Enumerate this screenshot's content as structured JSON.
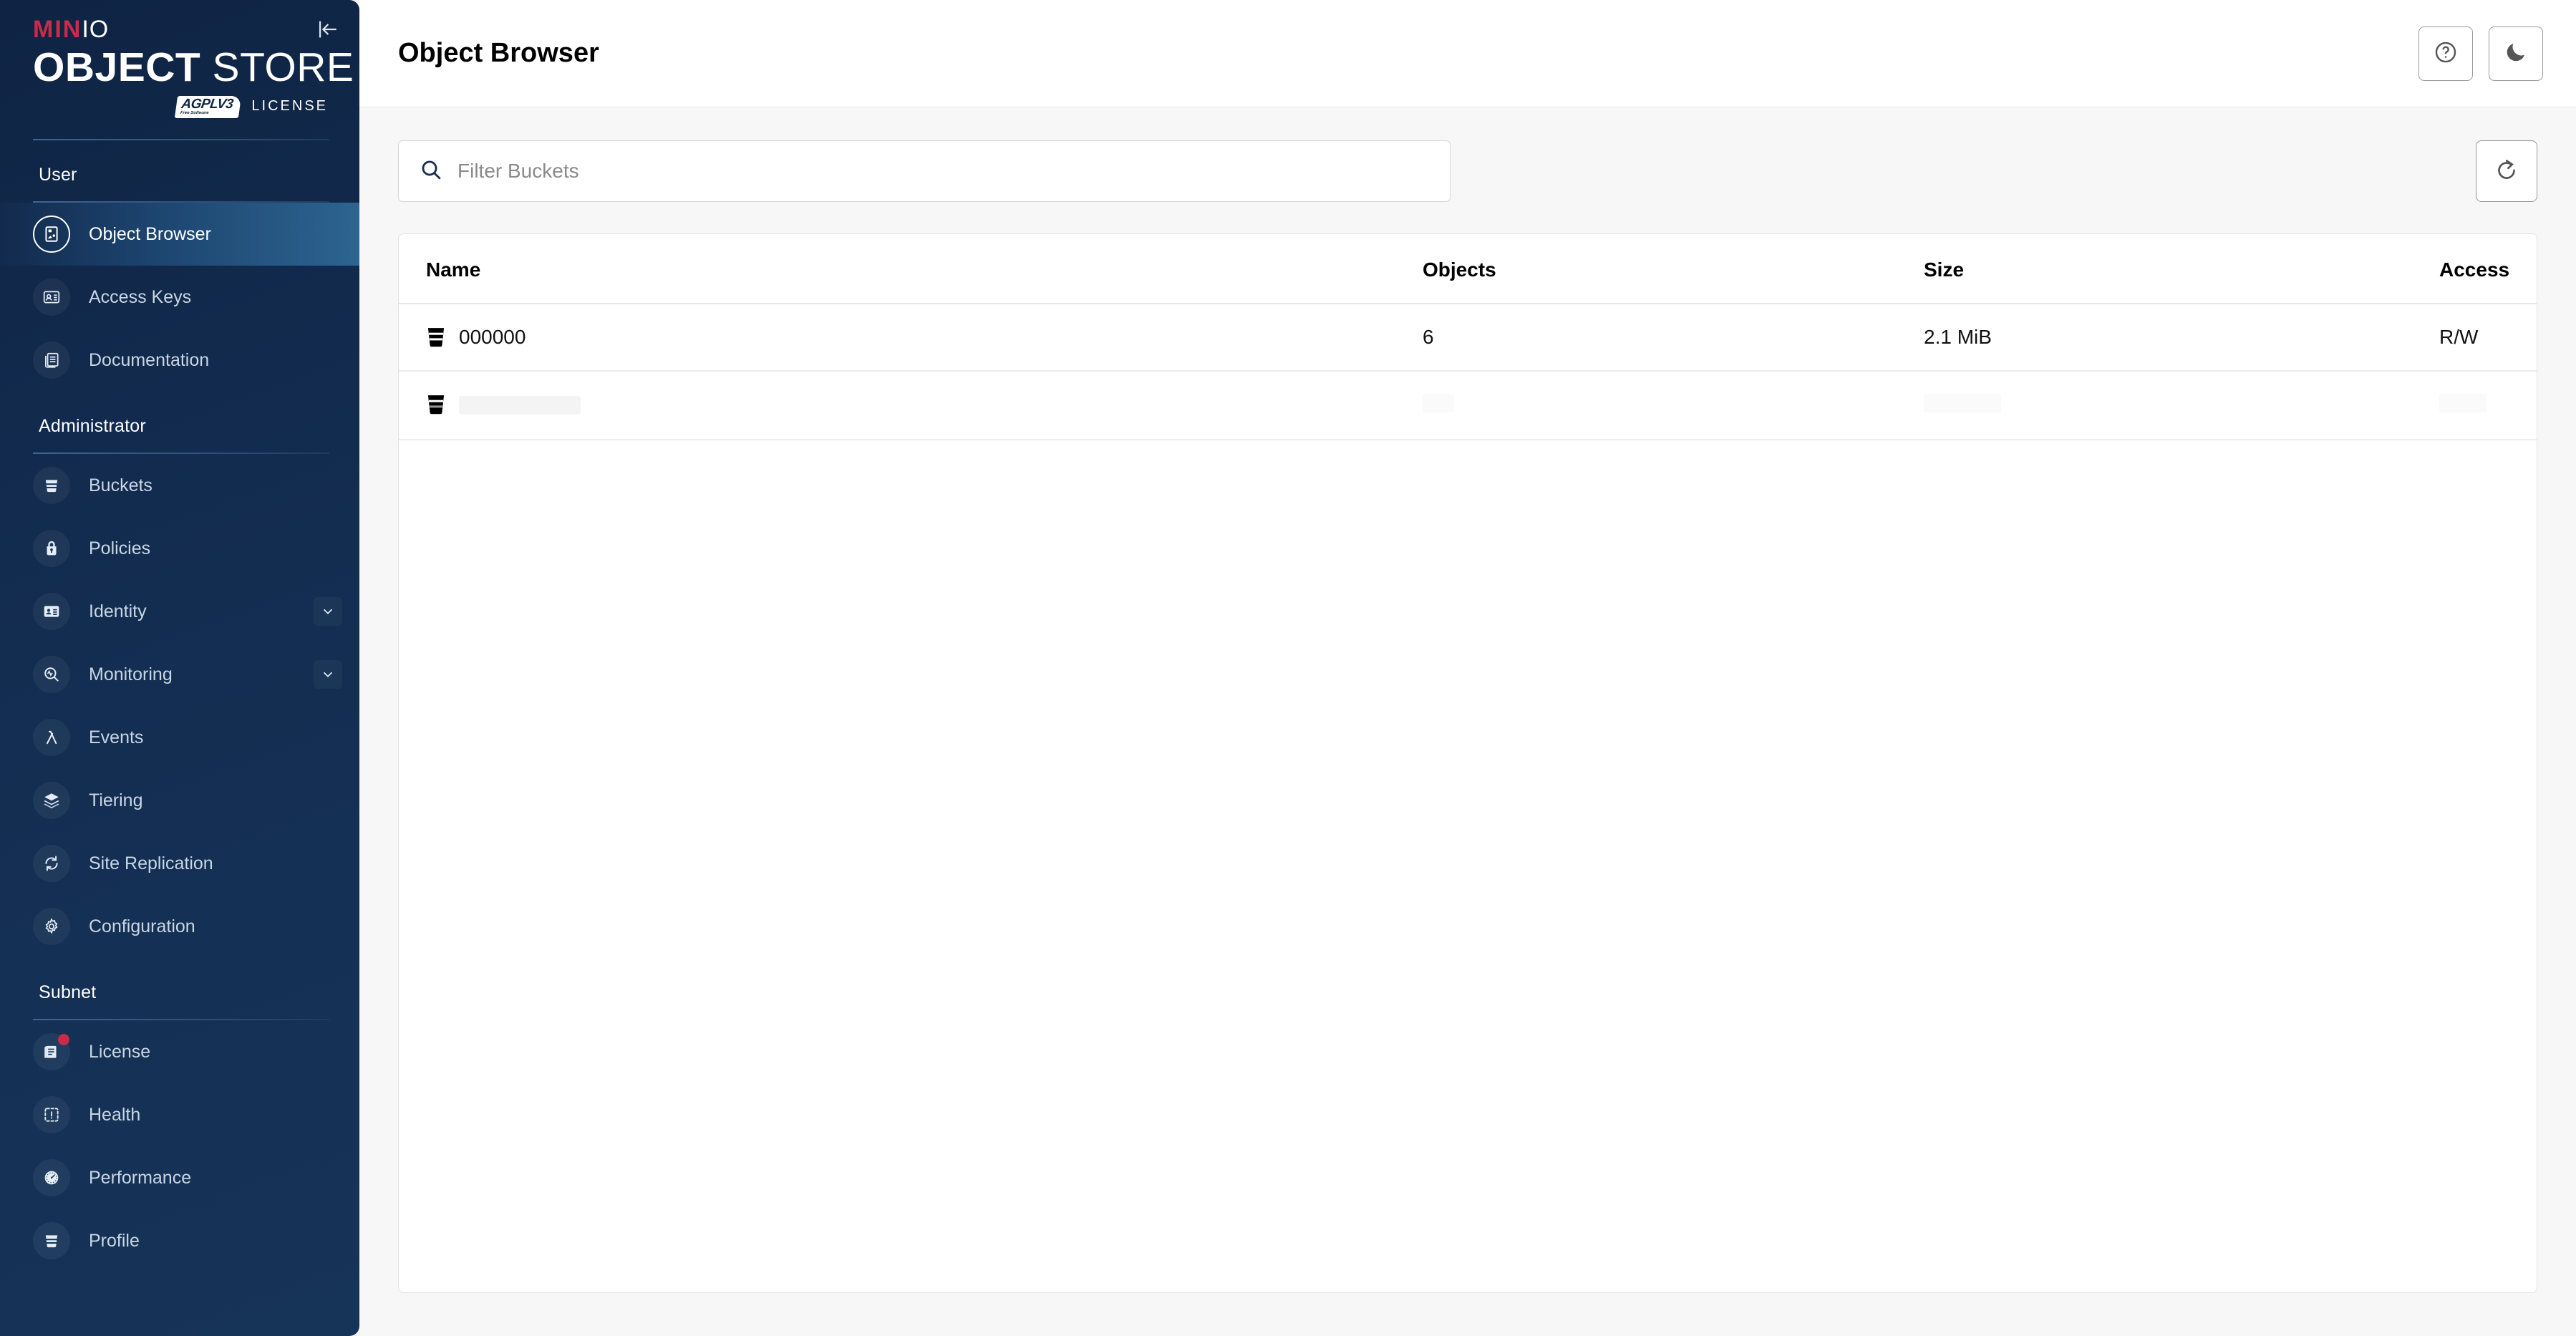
{
  "sidebar": {
    "logo": {
      "brand_min": "MIN",
      "brand_io": "IO",
      "product_bold": "OBJECT",
      "product_light": "STORE",
      "agpl_main": "AGPLV3",
      "agpl_sub": "Free Software",
      "license_word": "LICENSE"
    },
    "collapse_icon": "collapse-sidebar-icon",
    "sections": [
      {
        "label": "User",
        "items": [
          {
            "label": "Object Browser",
            "icon": "object-browser-icon",
            "active": true,
            "chevron": false,
            "badge": false
          },
          {
            "label": "Access Keys",
            "icon": "access-keys-icon",
            "active": false,
            "chevron": false,
            "badge": false
          },
          {
            "label": "Documentation",
            "icon": "documentation-icon",
            "active": false,
            "chevron": false,
            "badge": false
          }
        ]
      },
      {
        "label": "Administrator",
        "items": [
          {
            "label": "Buckets",
            "icon": "bucket-icon",
            "active": false,
            "chevron": false,
            "badge": false
          },
          {
            "label": "Policies",
            "icon": "lock-icon",
            "active": false,
            "chevron": false,
            "badge": false
          },
          {
            "label": "Identity",
            "icon": "identity-card-icon",
            "active": false,
            "chevron": true,
            "badge": false
          },
          {
            "label": "Monitoring",
            "icon": "monitoring-icon",
            "active": false,
            "chevron": true,
            "badge": false
          },
          {
            "label": "Events",
            "icon": "lambda-icon",
            "active": false,
            "chevron": false,
            "badge": false
          },
          {
            "label": "Tiering",
            "icon": "layers-icon",
            "active": false,
            "chevron": false,
            "badge": false
          },
          {
            "label": "Site Replication",
            "icon": "sync-icon",
            "active": false,
            "chevron": false,
            "badge": false
          },
          {
            "label": "Configuration",
            "icon": "gear-icon",
            "active": false,
            "chevron": false,
            "badge": false
          }
        ]
      },
      {
        "label": "Subnet",
        "items": [
          {
            "label": "License",
            "icon": "license-document-icon",
            "active": false,
            "chevron": false,
            "badge": true
          },
          {
            "label": "Health",
            "icon": "health-icon",
            "active": false,
            "chevron": false,
            "badge": false
          },
          {
            "label": "Performance",
            "icon": "gauge-icon",
            "active": false,
            "chevron": false,
            "badge": false
          },
          {
            "label": "Profile",
            "icon": "profile-bucket-icon",
            "active": false,
            "chevron": false,
            "badge": false
          }
        ]
      }
    ]
  },
  "topbar": {
    "title": "Object Browser",
    "help_icon": "help-circle-icon",
    "theme_icon": "moon-icon"
  },
  "toolbar": {
    "search_placeholder": "Filter Buckets",
    "search_value": "",
    "search_icon": "search-icon",
    "refresh_icon": "refresh-icon"
  },
  "table": {
    "columns": [
      "Name",
      "Objects",
      "Size",
      "Access"
    ],
    "rows": [
      {
        "name": "000000",
        "objects": "6",
        "size": "2.1 MiB",
        "access": "R/W",
        "loading": false
      },
      {
        "name": "",
        "objects": "",
        "size": "",
        "access": "",
        "loading": true
      }
    ]
  },
  "colors": {
    "sidebar_bg": "#132d51",
    "sidebar_active": "#2d6490",
    "brand_red": "#c72c48",
    "page_bg": "#f7f7f7",
    "card_bg": "#ffffff",
    "text_primary": "#000000",
    "text_muted": "#8a8a8a"
  }
}
